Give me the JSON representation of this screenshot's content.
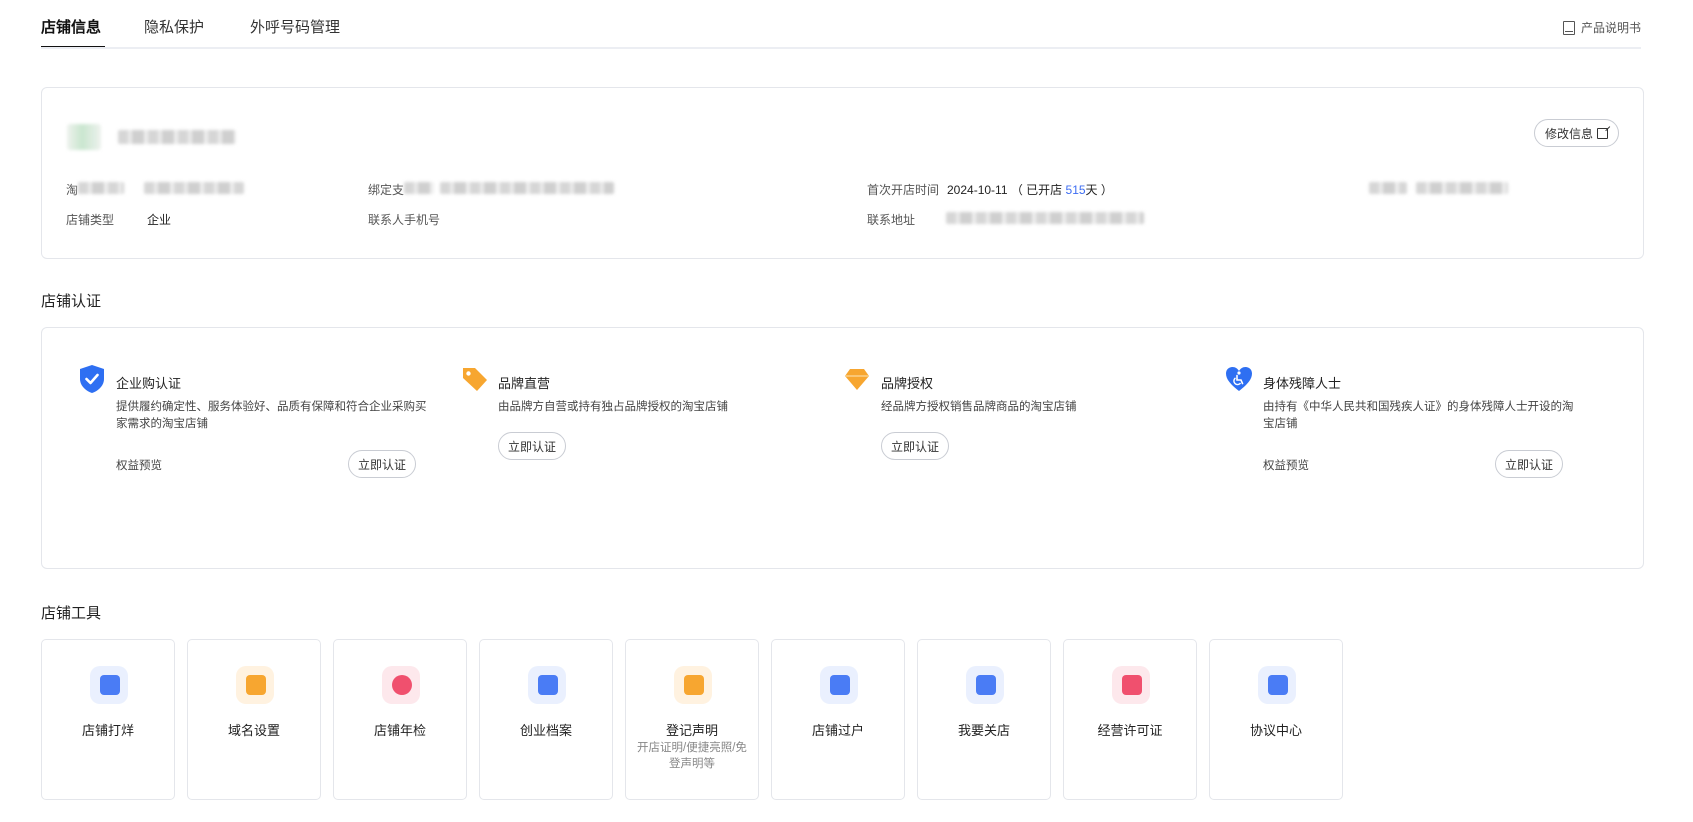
{
  "tabs": {
    "items": [
      "店铺信息",
      "隐私保护",
      "外呼号码管理"
    ],
    "manual": "产品说明书"
  },
  "store_info": {
    "edit_button": "修改信息",
    "taobao_label_prefix": "淘",
    "bind_label_prefix": "绑定支",
    "first_open_label": "首次开店时间",
    "first_open_date": "2024-10-11",
    "opened_prefix": "（ 已开店 ",
    "opened_days": "515",
    "opened_suffix": "天 ）",
    "store_type_label": "店铺类型",
    "store_type_value": "企业",
    "contact_phone_label": "联系人手机号",
    "contact_address_label": "联系地址"
  },
  "certification": {
    "title": "店铺认证",
    "items": [
      {
        "title": "企业购认证",
        "desc": "提供履约确定性、服务体验好、品质有保障和符合企业采购买家需求的淘宝店铺",
        "benefit": "权益预览",
        "button": "立即认证",
        "icon": "shield-check-icon",
        "color": "#2e6ff2"
      },
      {
        "title": "品牌直营",
        "desc": "由品牌方自营或持有独占品牌授权的淘宝店铺",
        "benefit": "",
        "button": "立即认证",
        "icon": "tag-icon",
        "color": "#f7a630"
      },
      {
        "title": "品牌授权",
        "desc": "经品牌方授权销售品牌商品的淘宝店铺",
        "benefit": "",
        "button": "立即认证",
        "icon": "diamond-icon",
        "color": "#f7a630"
      },
      {
        "title": "身体残障人士",
        "desc": "由持有《中华人民共和国残疾人证》的身体残障人士开设的淘宝店铺",
        "benefit": "权益预览",
        "button": "立即认证",
        "icon": "accessible-heart-icon",
        "color": "#2e6ff2"
      }
    ]
  },
  "tools": {
    "title": "店铺工具",
    "items": [
      {
        "label": "店铺打烊",
        "sub": "",
        "icon": "store-close-icon",
        "color": "#4a7cf5"
      },
      {
        "label": "域名设置",
        "sub": "",
        "icon": "domain-icon",
        "color": "#f7a630"
      },
      {
        "label": "店铺年检",
        "sub": "",
        "icon": "shield-search-icon",
        "color": "#f0506e"
      },
      {
        "label": "创业档案",
        "sub": "",
        "icon": "archive-icon",
        "color": "#4a7cf5"
      },
      {
        "label": "登记声明",
        "sub": "开店证明/便捷亮照/免登声明等",
        "icon": "document-icon",
        "color": "#f7a630"
      },
      {
        "label": "店铺过户",
        "sub": "",
        "icon": "transfer-icon",
        "color": "#4a7cf5"
      },
      {
        "label": "我要关店",
        "sub": "",
        "icon": "close-store-icon",
        "color": "#4a7cf5"
      },
      {
        "label": "经营许可证",
        "sub": "",
        "icon": "license-folder-icon",
        "color": "#f0506e"
      },
      {
        "label": "协议中心",
        "sub": "",
        "icon": "agreement-icon",
        "color": "#4a7cf5"
      }
    ]
  }
}
